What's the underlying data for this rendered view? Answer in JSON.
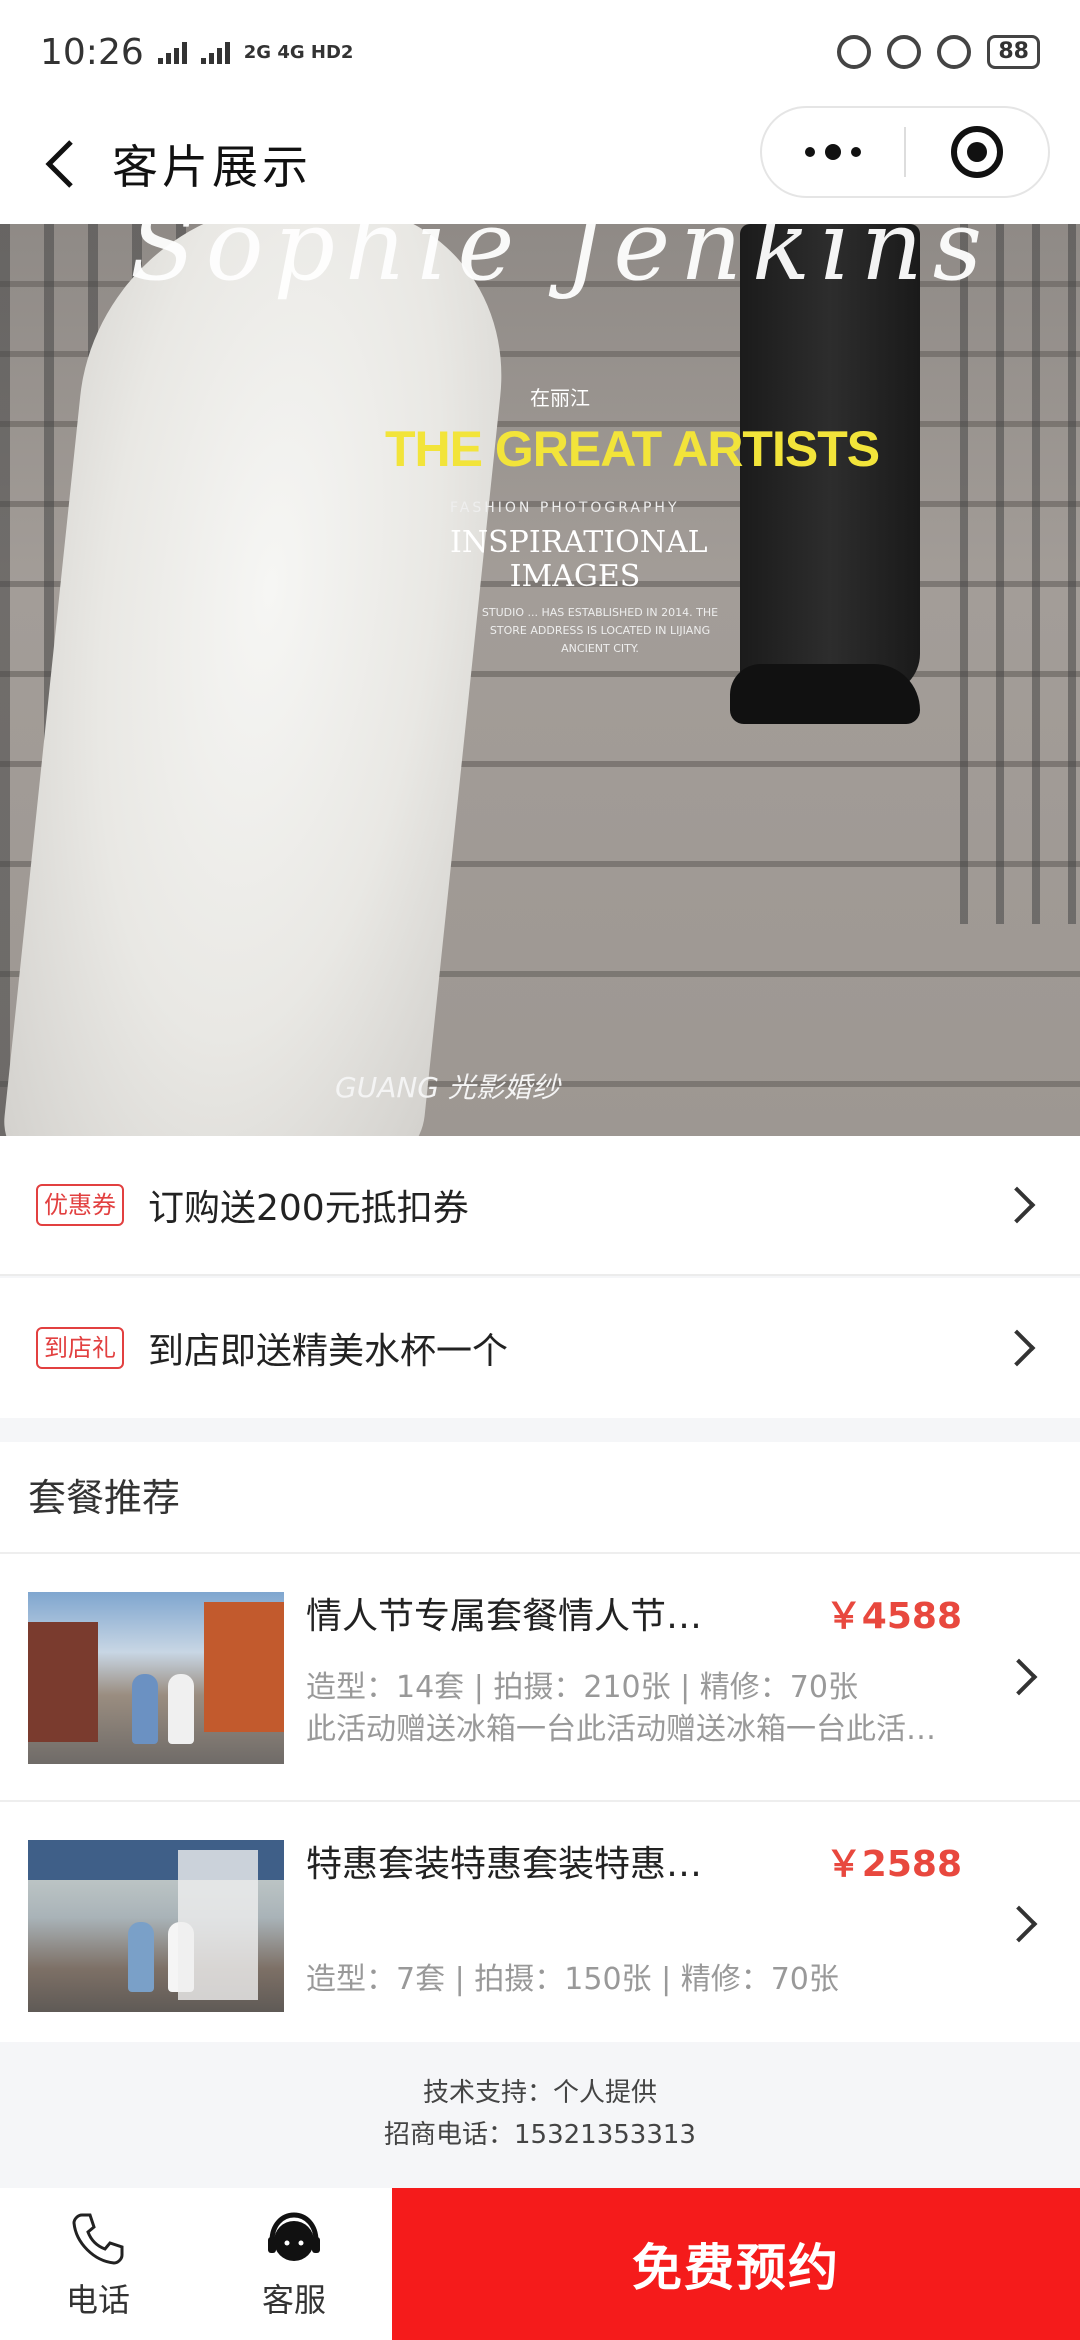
{
  "status_bar": {
    "time": "10:26",
    "network": "2G 4G HD2",
    "battery": "88"
  },
  "nav": {
    "title": "客片展示"
  },
  "banner": {
    "script_text": "Sophie Jenkins",
    "location": "在丽江",
    "headline": "THE GREAT ARTISTS",
    "fashion": "FASHION PHOTOGRAPHY",
    "inspirational": "INSPIRATIONAL IMAGES",
    "small_text": "STUDIO ... HAS ESTABLISHED IN 2014. THE STORE ADDRESS IS LOCATED IN LIJIANG ANCIENT CITY.",
    "brand": "GUANG 光影婚纱"
  },
  "promos": [
    {
      "tag": "优惠券",
      "text": "订购送200元抵扣券"
    },
    {
      "tag": "到店礼",
      "text": "到店即送精美水杯一个"
    }
  ],
  "packages": {
    "title": "套餐推荐",
    "items": [
      {
        "name": "情人节专属套餐情人节专属套餐",
        "price": "￥4588",
        "spec": "造型：14套 | 拍摄：210张 | 精修：70张",
        "desc": "此活动赠送冰箱一台此活动赠送冰箱一台此活动赠送冰箱一台"
      },
      {
        "name": "特惠套装特惠套装特惠套装",
        "price": "￥2588",
        "spec": "造型：7套 | 拍摄：150张 | 精修：70张",
        "desc": ""
      }
    ]
  },
  "footer": {
    "support": "技术支持：个人提供",
    "phone": "招商电话：15321353313"
  },
  "bottom_bar": {
    "phone_label": "电话",
    "service_label": "客服",
    "cta_label": "免费预约"
  },
  "colors": {
    "accent_red": "#f51b1b",
    "price_red": "#e8483e",
    "headline_yellow": "#f2e43a"
  }
}
